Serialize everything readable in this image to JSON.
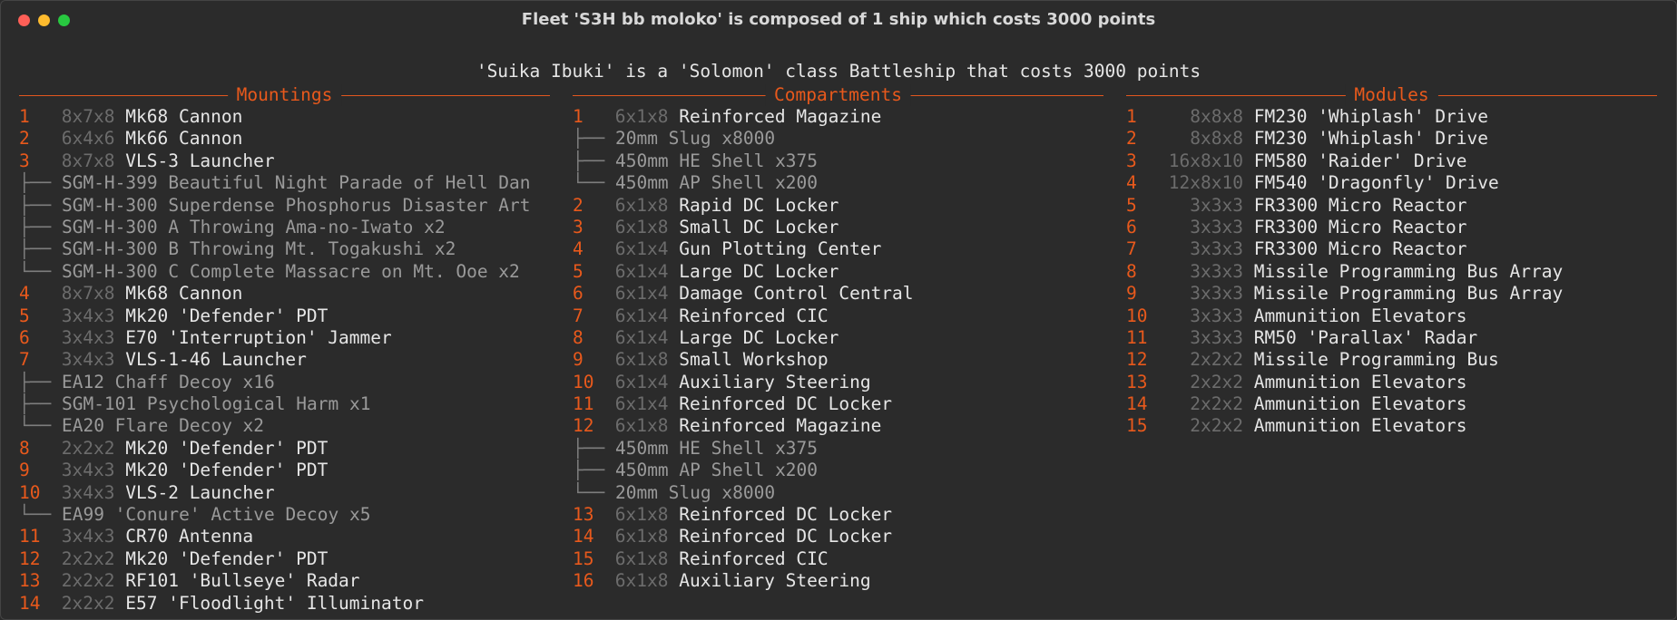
{
  "window": {
    "title": "Fleet 'S3H bb moloko' is composed of 1 ship which costs 3000 points"
  },
  "ship_heading": "'Suika Ibuki' is a 'Solomon' class Battleship that costs 3000 points",
  "mountings": {
    "title": "Mountings",
    "rows": [
      {
        "num": "1",
        "size": "8x7x8",
        "name": "Mk68 Cannon",
        "tree": "",
        "sub": ""
      },
      {
        "num": "2",
        "size": "6x4x6",
        "name": "Mk66 Cannon",
        "tree": "",
        "sub": ""
      },
      {
        "num": "3",
        "size": "8x7x8",
        "name": "VLS-3 Launcher",
        "tree": "",
        "sub": ""
      },
      {
        "num": "",
        "size": "",
        "name": "",
        "tree": "├── ",
        "sub": "SGM-H-399 Beautiful Night Parade of Hell Dan"
      },
      {
        "num": "",
        "size": "",
        "name": "",
        "tree": "├── ",
        "sub": "SGM-H-300 Superdense Phosphorus Disaster Art"
      },
      {
        "num": "",
        "size": "",
        "name": "",
        "tree": "├── ",
        "sub": "SGM-H-300 A Throwing Ama-no-Iwato x2"
      },
      {
        "num": "",
        "size": "",
        "name": "",
        "tree": "├── ",
        "sub": "SGM-H-300 B Throwing Mt. Togakushi x2"
      },
      {
        "num": "",
        "size": "",
        "name": "",
        "tree": "└── ",
        "sub": "SGM-H-300 C Complete Massacre on Mt. Ooe x2"
      },
      {
        "num": "4",
        "size": "8x7x8",
        "name": "Mk68 Cannon",
        "tree": "",
        "sub": ""
      },
      {
        "num": "5",
        "size": "3x4x3",
        "name": "Mk20 'Defender' PDT",
        "tree": "",
        "sub": ""
      },
      {
        "num": "6",
        "size": "3x4x3",
        "name": "E70 'Interruption' Jammer",
        "tree": "",
        "sub": ""
      },
      {
        "num": "7",
        "size": "3x4x3",
        "name": "VLS-1-46 Launcher",
        "tree": "",
        "sub": ""
      },
      {
        "num": "",
        "size": "",
        "name": "",
        "tree": "├── ",
        "sub": "EA12 Chaff Decoy x16"
      },
      {
        "num": "",
        "size": "",
        "name": "",
        "tree": "├── ",
        "sub": "SGM-101 Psychological Harm x1"
      },
      {
        "num": "",
        "size": "",
        "name": "",
        "tree": "└── ",
        "sub": "EA20 Flare Decoy x2"
      },
      {
        "num": "8",
        "size": "2x2x2",
        "name": "Mk20 'Defender' PDT",
        "tree": "",
        "sub": ""
      },
      {
        "num": "9",
        "size": "3x4x3",
        "name": "Mk20 'Defender' PDT",
        "tree": "",
        "sub": ""
      },
      {
        "num": "10",
        "size": "3x4x3",
        "name": "VLS-2 Launcher",
        "tree": "",
        "sub": ""
      },
      {
        "num": "",
        "size": "",
        "name": "",
        "tree": "└── ",
        "sub": "EA99 'Conure' Active Decoy x5"
      },
      {
        "num": "11",
        "size": "3x4x3",
        "name": "CR70 Antenna",
        "tree": "",
        "sub": ""
      },
      {
        "num": "12",
        "size": "2x2x2",
        "name": "Mk20 'Defender' PDT",
        "tree": "",
        "sub": ""
      },
      {
        "num": "13",
        "size": "2x2x2",
        "name": "RF101 'Bullseye' Radar",
        "tree": "",
        "sub": ""
      },
      {
        "num": "14",
        "size": "2x2x2",
        "name": "E57 'Floodlight' Illuminator",
        "tree": "",
        "sub": ""
      }
    ]
  },
  "compartments": {
    "title": "Compartments",
    "rows": [
      {
        "num": "1",
        "size": "6x1x8",
        "name": "Reinforced Magazine",
        "tree": "",
        "sub": ""
      },
      {
        "num": "",
        "size": "",
        "name": "",
        "tree": "├── ",
        "sub": "20mm Slug x8000"
      },
      {
        "num": "",
        "size": "",
        "name": "",
        "tree": "├── ",
        "sub": "450mm HE Shell x375"
      },
      {
        "num": "",
        "size": "",
        "name": "",
        "tree": "└── ",
        "sub": "450mm AP Shell x200"
      },
      {
        "num": "2",
        "size": "6x1x8",
        "name": "Rapid DC Locker",
        "tree": "",
        "sub": ""
      },
      {
        "num": "3",
        "size": "6x1x8",
        "name": "Small DC Locker",
        "tree": "",
        "sub": ""
      },
      {
        "num": "4",
        "size": "6x1x4",
        "name": "Gun Plotting Center",
        "tree": "",
        "sub": ""
      },
      {
        "num": "5",
        "size": "6x1x4",
        "name": "Large DC Locker",
        "tree": "",
        "sub": ""
      },
      {
        "num": "6",
        "size": "6x1x4",
        "name": "Damage Control Central",
        "tree": "",
        "sub": ""
      },
      {
        "num": "7",
        "size": "6x1x4",
        "name": "Reinforced CIC",
        "tree": "",
        "sub": ""
      },
      {
        "num": "8",
        "size": "6x1x4",
        "name": "Large DC Locker",
        "tree": "",
        "sub": ""
      },
      {
        "num": "9",
        "size": "6x1x8",
        "name": "Small Workshop",
        "tree": "",
        "sub": ""
      },
      {
        "num": "10",
        "size": "6x1x4",
        "name": "Auxiliary Steering",
        "tree": "",
        "sub": ""
      },
      {
        "num": "11",
        "size": "6x1x4",
        "name": "Reinforced DC Locker",
        "tree": "",
        "sub": ""
      },
      {
        "num": "12",
        "size": "6x1x8",
        "name": "Reinforced Magazine",
        "tree": "",
        "sub": ""
      },
      {
        "num": "",
        "size": "",
        "name": "",
        "tree": "├── ",
        "sub": "450mm HE Shell x375"
      },
      {
        "num": "",
        "size": "",
        "name": "",
        "tree": "├── ",
        "sub": "450mm AP Shell x200"
      },
      {
        "num": "",
        "size": "",
        "name": "",
        "tree": "└── ",
        "sub": "20mm Slug x8000"
      },
      {
        "num": "13",
        "size": "6x1x8",
        "name": "Reinforced DC Locker",
        "tree": "",
        "sub": ""
      },
      {
        "num": "14",
        "size": "6x1x8",
        "name": "Reinforced DC Locker",
        "tree": "",
        "sub": ""
      },
      {
        "num": "15",
        "size": "6x1x8",
        "name": "Reinforced CIC",
        "tree": "",
        "sub": ""
      },
      {
        "num": "16",
        "size": "6x1x8",
        "name": "Auxiliary Steering",
        "tree": "",
        "sub": ""
      }
    ]
  },
  "modules": {
    "title": "Modules",
    "rows": [
      {
        "num": "1",
        "size": "  8x8x8",
        "name": "FM230 'Whiplash' Drive",
        "tree": "",
        "sub": ""
      },
      {
        "num": "2",
        "size": "  8x8x8",
        "name": "FM230 'Whiplash' Drive",
        "tree": "",
        "sub": ""
      },
      {
        "num": "3",
        "size": "16x8x10",
        "name": "FM580 'Raider' Drive",
        "tree": "",
        "sub": ""
      },
      {
        "num": "4",
        "size": "12x8x10",
        "name": "FM540 'Dragonfly' Drive",
        "tree": "",
        "sub": ""
      },
      {
        "num": "5",
        "size": "  3x3x3",
        "name": "FR3300 Micro Reactor",
        "tree": "",
        "sub": ""
      },
      {
        "num": "6",
        "size": "  3x3x3",
        "name": "FR3300 Micro Reactor",
        "tree": "",
        "sub": ""
      },
      {
        "num": "7",
        "size": "  3x3x3",
        "name": "FR3300 Micro Reactor",
        "tree": "",
        "sub": ""
      },
      {
        "num": "8",
        "size": "  3x3x3",
        "name": "Missile Programming Bus Array",
        "tree": "",
        "sub": ""
      },
      {
        "num": "9",
        "size": "  3x3x3",
        "name": "Missile Programming Bus Array",
        "tree": "",
        "sub": ""
      },
      {
        "num": "10",
        "size": "  3x3x3",
        "name": "Ammunition Elevators",
        "tree": "",
        "sub": ""
      },
      {
        "num": "11",
        "size": "  3x3x3",
        "name": "RM50 'Parallax' Radar",
        "tree": "",
        "sub": ""
      },
      {
        "num": "12",
        "size": "  2x2x2",
        "name": "Missile Programming Bus",
        "tree": "",
        "sub": ""
      },
      {
        "num": "13",
        "size": "  2x2x2",
        "name": "Ammunition Elevators",
        "tree": "",
        "sub": ""
      },
      {
        "num": "14",
        "size": "  2x2x2",
        "name": "Ammunition Elevators",
        "tree": "",
        "sub": ""
      },
      {
        "num": "15",
        "size": "  2x2x2",
        "name": "Ammunition Elevators",
        "tree": "",
        "sub": ""
      }
    ]
  }
}
